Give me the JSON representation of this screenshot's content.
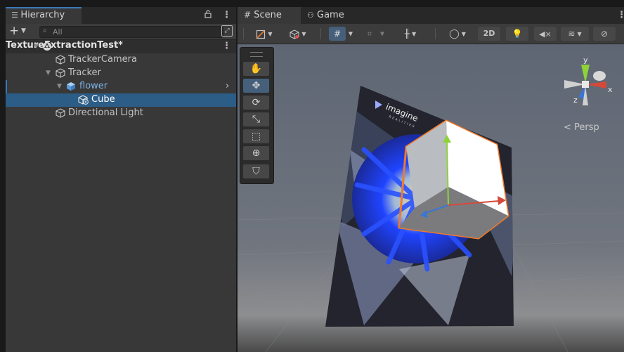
{
  "hierarchy": {
    "tab_label": "Hierarchy",
    "search_placeholder": "All",
    "scene_name": "TextureExtractionTest*",
    "items": [
      {
        "label": "TrackerCamera"
      },
      {
        "label": "Tracker"
      },
      {
        "label": "flower"
      },
      {
        "label": "Cube"
      },
      {
        "label": "Directional Light"
      }
    ]
  },
  "scene_view": {
    "tabs": [
      {
        "label": "Scene"
      },
      {
        "label": "Game"
      }
    ],
    "toolbar": {
      "mode_2d_label": "2D"
    },
    "persp_label": "< Persp",
    "gizmo_axes": {
      "y": "y",
      "x": "x",
      "z": "z"
    }
  },
  "overlay_text": {
    "brand_line1": "imagine",
    "brand_line2": "REALITIES"
  },
  "colors": {
    "accent_blue": "#3a79bb",
    "selected_row": "#2c5d87",
    "prefab_blue": "#7fb3e8",
    "selection_outline": "#f07a2a",
    "axis_x": "#d44a3a",
    "axis_y": "#8ed23a",
    "axis_z": "#3a76d4"
  }
}
